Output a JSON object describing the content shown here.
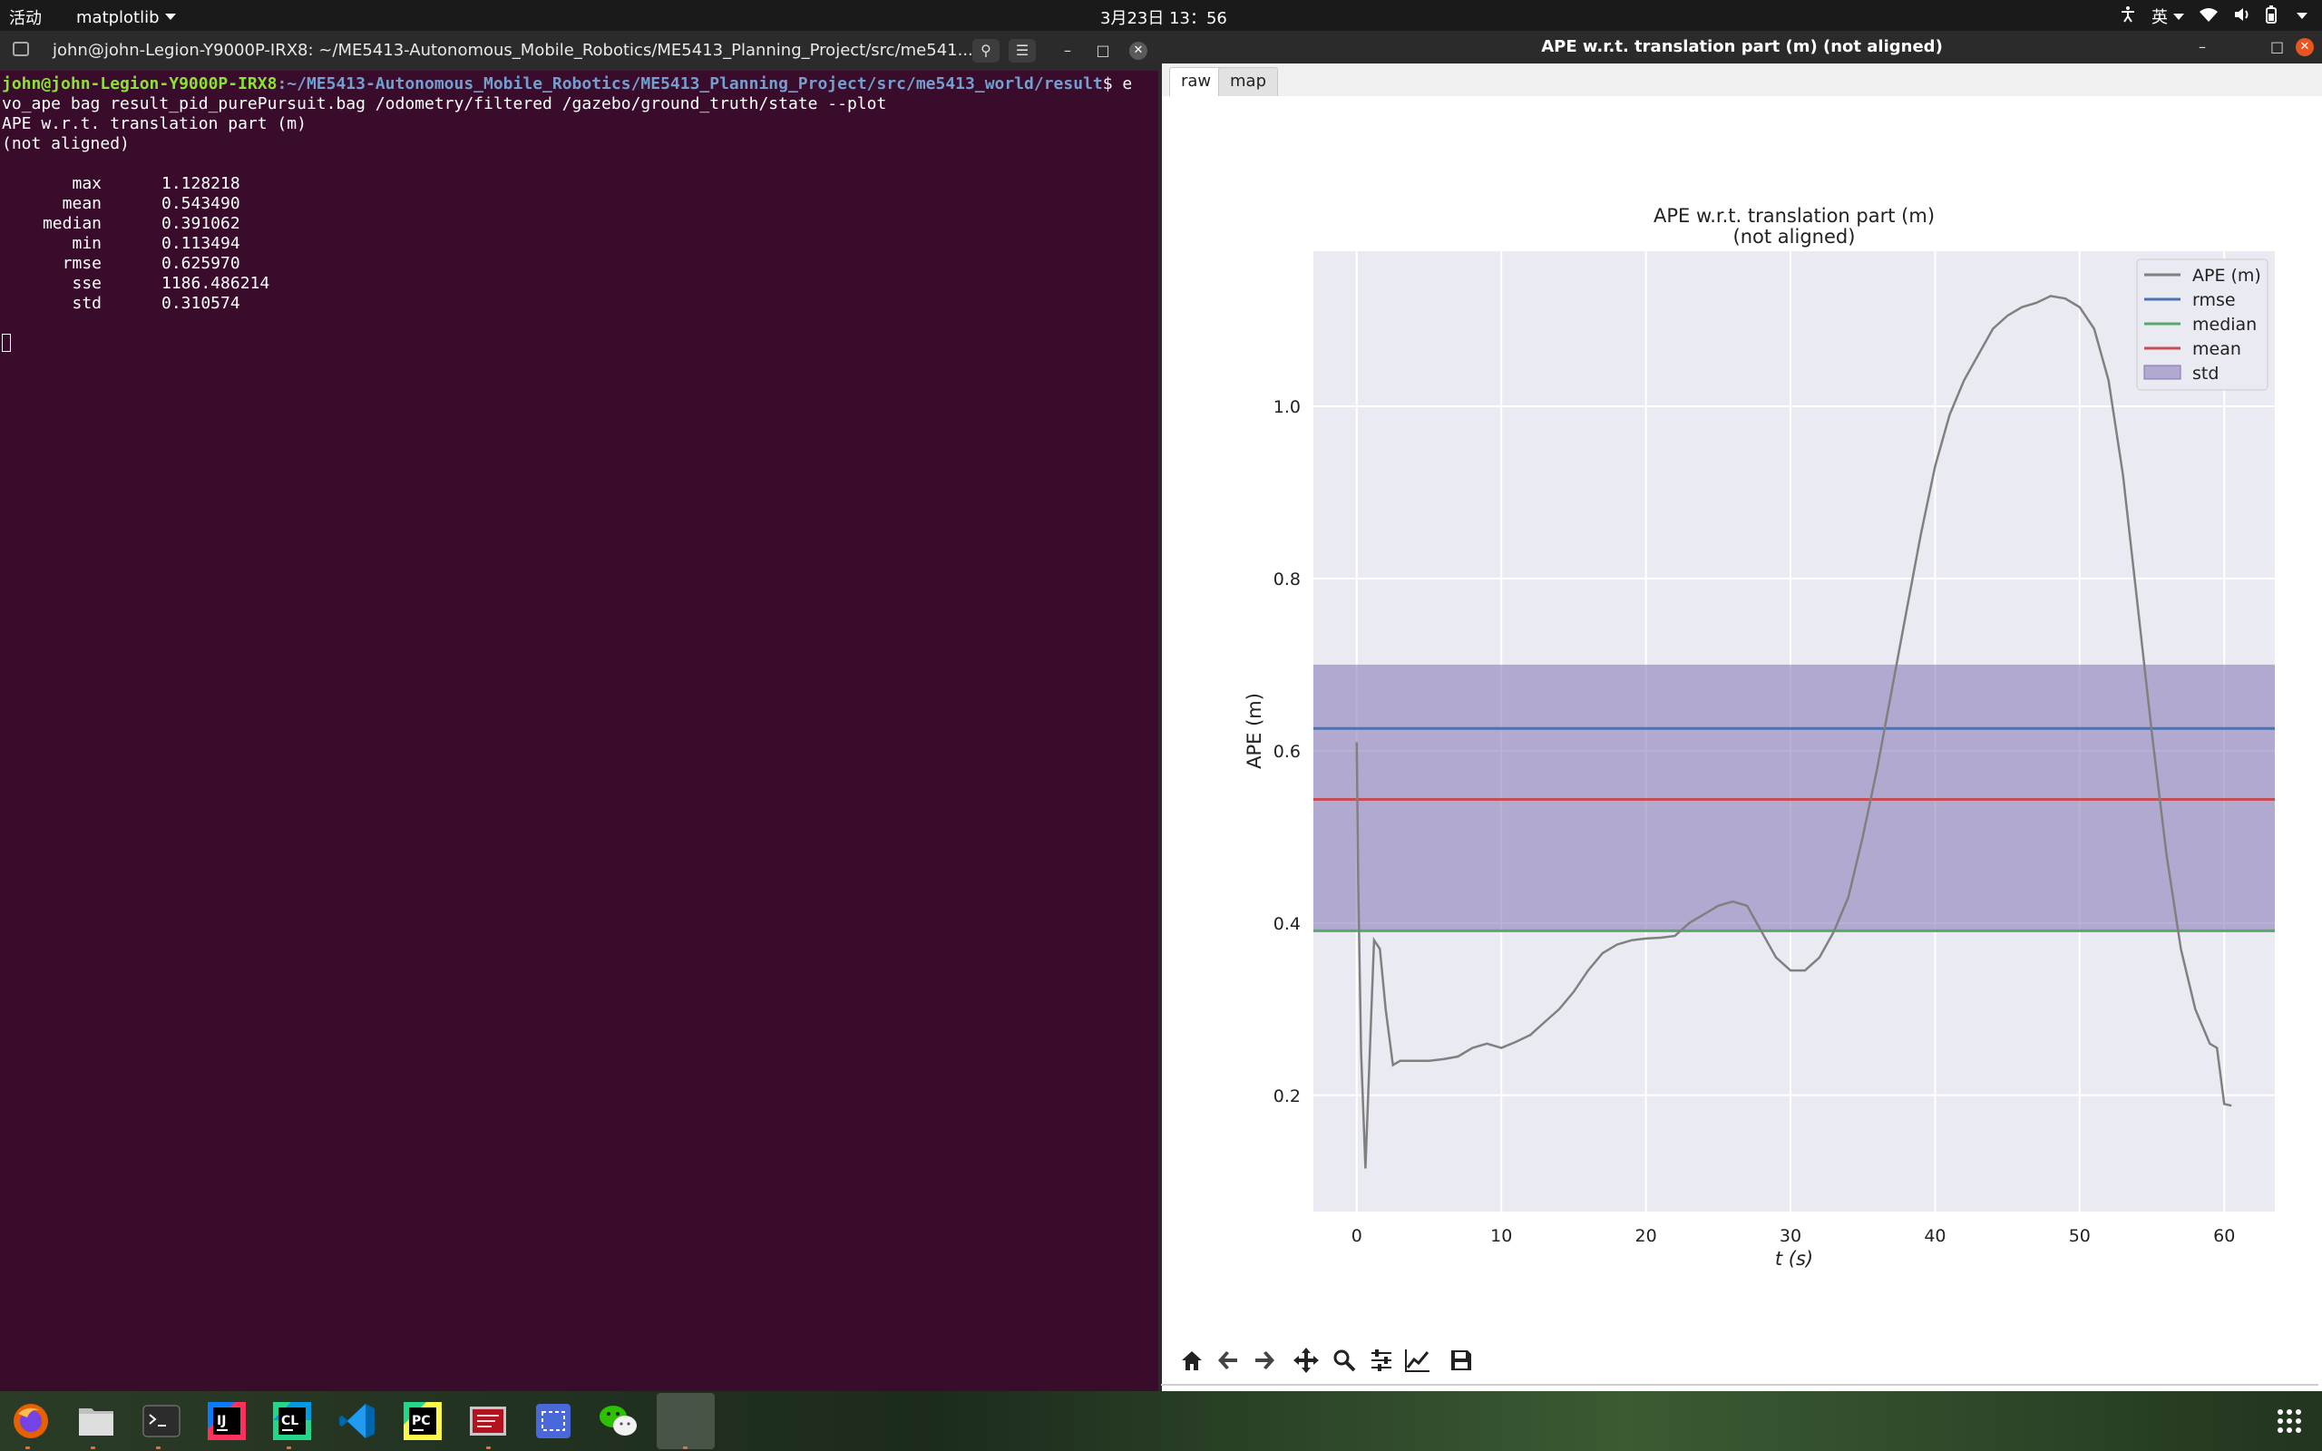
{
  "topbar": {
    "activities": "活动",
    "app_menu": "matplotlib",
    "clock": "3月23日  13：56",
    "input_method": "英"
  },
  "terminal": {
    "title": "john@john-Legion-Y9000P-IRX8: ~/ME5413-Autonomous_Mobile_Robotics/ME5413_Planning_Project/src/me541...",
    "prompt_user": "john@john-Legion-Y9000P-IRX8",
    "prompt_path": ":~/ME5413-Autonomous_Mobile_Robotics/ME5413_Planning_Project/src/me5413_world/result",
    "prompt_tail": "$ e",
    "command_line2": "vo_ape bag result_pid_purePursuit.bag /odometry/filtered /gazebo/ground_truth/state --plot",
    "output_title1": "APE w.r.t. translation part (m)",
    "output_title2": "(not aligned)",
    "stats": [
      {
        "name": "max",
        "value": "1.128218"
      },
      {
        "name": "mean",
        "value": "0.543490"
      },
      {
        "name": "median",
        "value": "0.391062"
      },
      {
        "name": "min",
        "value": "0.113494"
      },
      {
        "name": "rmse",
        "value": "0.625970"
      },
      {
        "name": "sse",
        "value": "1186.486214"
      },
      {
        "name": "std",
        "value": "0.310574"
      }
    ]
  },
  "plot_window": {
    "title": "APE w.r.t. translation part (m) (not aligned)",
    "tabs": [
      "raw",
      "map"
    ],
    "toolbar": [
      "home-icon",
      "back-icon",
      "forward-icon",
      "pan-icon",
      "zoom-icon",
      "configure-icon",
      "edit-curves-icon",
      "save-icon"
    ]
  },
  "chart_data": {
    "type": "line",
    "title": "APE w.r.t. translation part (m)",
    "subtitle": "(not aligned)",
    "xlabel": "t (s)",
    "ylabel": "APE (m)",
    "xlim": [
      -3,
      63.5
    ],
    "ylim": [
      0.065,
      1.18
    ],
    "xticks": [
      0,
      10,
      20,
      30,
      40,
      50,
      60
    ],
    "yticks": [
      0.2,
      0.4,
      0.6,
      0.8,
      1.0
    ],
    "ytick_labels": [
      "0.2",
      "0.4",
      "0.6",
      "0.8",
      "1.0"
    ],
    "grid": true,
    "legend_position": "top-right",
    "legend": [
      "APE (m)",
      "rmse",
      "median",
      "mean",
      "std"
    ],
    "colors": {
      "ape": "#808080",
      "rmse": "#4c72b0",
      "median": "#55a868",
      "mean": "#c44e52",
      "std": "#8172b2",
      "background": "#eaeaf2"
    },
    "series": [
      {
        "name": "APE (m)",
        "x": [
          0,
          0.1,
          0.3,
          0.6,
          0.9,
          1.2,
          1.6,
          2.0,
          2.5,
          3,
          4,
          5,
          6,
          7,
          8,
          9,
          10,
          11,
          12,
          13,
          14,
          15,
          16,
          17,
          18,
          19,
          20,
          21,
          22,
          23,
          24,
          25,
          26,
          27,
          28,
          29,
          30,
          31,
          32,
          33,
          34,
          35,
          36,
          37,
          38,
          39,
          40,
          41,
          42,
          43,
          44,
          45,
          46,
          47,
          48,
          49,
          50,
          51,
          52,
          53,
          54,
          55,
          56,
          57,
          58,
          59,
          59.5,
          60,
          60.5
        ],
        "y": [
          0.61,
          0.45,
          0.25,
          0.115,
          0.25,
          0.38,
          0.37,
          0.3,
          0.235,
          0.24,
          0.24,
          0.24,
          0.242,
          0.245,
          0.255,
          0.26,
          0.255,
          0.262,
          0.27,
          0.285,
          0.3,
          0.32,
          0.345,
          0.365,
          0.375,
          0.38,
          0.382,
          0.383,
          0.385,
          0.4,
          0.41,
          0.42,
          0.425,
          0.42,
          0.39,
          0.36,
          0.345,
          0.345,
          0.36,
          0.39,
          0.43,
          0.5,
          0.58,
          0.67,
          0.76,
          0.85,
          0.93,
          0.99,
          1.03,
          1.06,
          1.09,
          1.105,
          1.115,
          1.12,
          1.128,
          1.125,
          1.115,
          1.09,
          1.03,
          0.92,
          0.77,
          0.62,
          0.48,
          0.37,
          0.3,
          0.26,
          0.255,
          0.19,
          0.188
        ]
      },
      {
        "name": "rmse",
        "value": 0.62597
      },
      {
        "name": "median",
        "value": 0.391062
      },
      {
        "name": "mean",
        "value": 0.54349
      },
      {
        "name": "std",
        "range": [
          0.39,
          0.7
        ]
      }
    ]
  },
  "taskbar": {
    "apps": [
      "firefox-icon",
      "files-icon",
      "terminal-icon",
      "intellij-icon",
      "clion-icon",
      "vscode-icon",
      "pycharm-icon",
      "presentation-icon",
      "screenshot-icon",
      "wechat-icon",
      "matplotlib-window-icon"
    ],
    "labels": {
      "intellij": "IJ",
      "clion": "CL",
      "pycharm": "PC"
    }
  }
}
